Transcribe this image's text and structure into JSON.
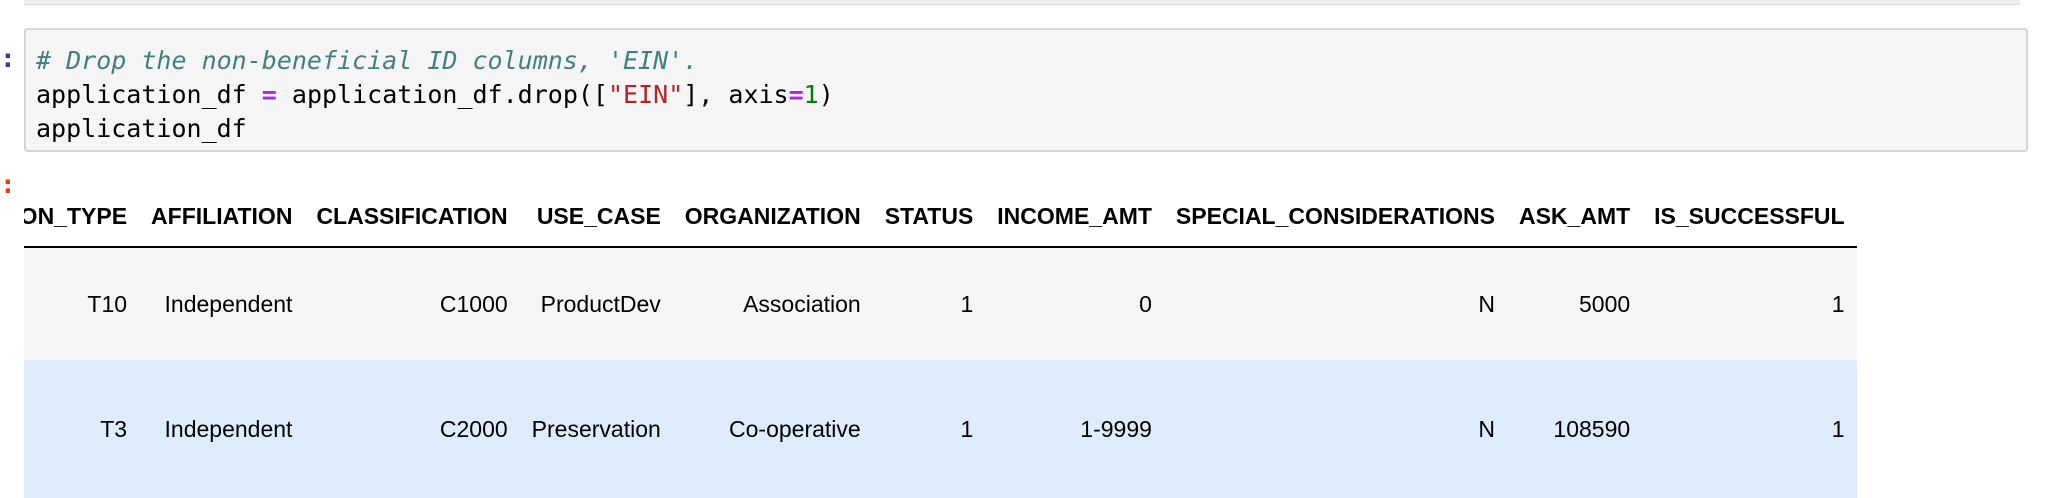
{
  "cell": {
    "prompt_marker": ":",
    "code_lines": [
      {
        "parts": [
          {
            "kind": "comment",
            "text": "# Drop the non-beneficial ID columns, 'EIN'."
          }
        ]
      },
      {
        "parts": [
          {
            "kind": "plain",
            "text": "application_df "
          },
          {
            "kind": "op",
            "text": "="
          },
          {
            "kind": "plain",
            "text": " application_df.drop(["
          },
          {
            "kind": "str",
            "text": "\"EIN\""
          },
          {
            "kind": "plain",
            "text": "], axis"
          },
          {
            "kind": "op",
            "text": "="
          },
          {
            "kind": "num",
            "text": "1"
          },
          {
            "kind": "plain",
            "text": ")"
          }
        ]
      },
      {
        "parts": [
          {
            "kind": "plain",
            "text": "application_df"
          }
        ]
      }
    ]
  },
  "output": {
    "prompt_marker": ":",
    "columns": [
      "APPLICATION_TYPE",
      "AFFILIATION",
      "CLASSIFICATION",
      "USE_CASE",
      "ORGANIZATION",
      "STATUS",
      "INCOME_AMT",
      "SPECIAL_CONSIDERATIONS",
      "ASK_AMT",
      "IS_SUCCESSFUL"
    ],
    "rows": [
      [
        "T10",
        "Independent",
        "C1000",
        "ProductDev",
        "Association",
        "1",
        "0",
        "N",
        "5000",
        "1"
      ],
      [
        "T3",
        "Independent",
        "C2000",
        "Preservation",
        "Co-operative",
        "1",
        "1-9999",
        "N",
        "108590",
        "1"
      ]
    ]
  },
  "colors": {
    "cell_background": "#f5f5f5",
    "row_even": "#f5f5f5",
    "row_odd": "#deebfa",
    "comment": "#408080",
    "operator": "#aa22ff",
    "string": "#ba2121",
    "number": "#008000"
  }
}
